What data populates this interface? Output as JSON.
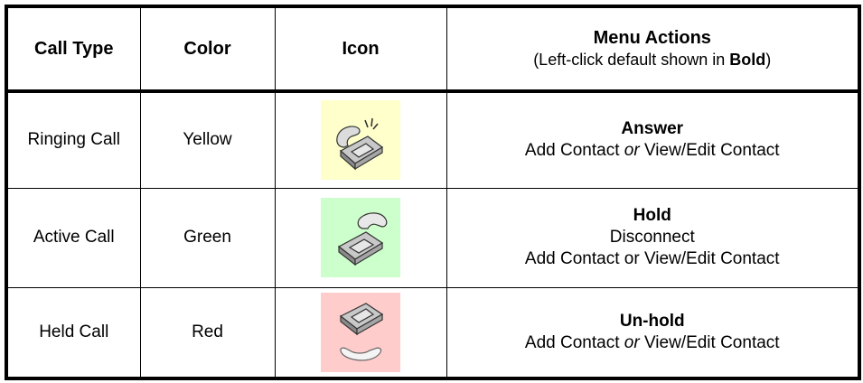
{
  "header": {
    "call_type": "Call Type",
    "color": "Color",
    "icon": "Icon",
    "menu_actions": "Menu Actions",
    "menu_sub_prefix": "(Left-click default shown in ",
    "menu_sub_bold": "Bold",
    "menu_sub_suffix": ")"
  },
  "rows": [
    {
      "call_type": "Ringing Call",
      "color": "Yellow",
      "icon_name": "ringing-phone-icon",
      "icon_bg": "#ffffcc",
      "actions": {
        "default": "Answer",
        "line1_a": "Add Contact ",
        "line1_or": "or",
        "line1_b": " View/Edit Contact"
      }
    },
    {
      "call_type": "Active Call",
      "color": "Green",
      "icon_name": "active-phone-icon",
      "icon_bg": "#ccffcc",
      "actions": {
        "default": "Hold",
        "line1": "Disconnect",
        "line2": "Add Contact or View/Edit Contact"
      }
    },
    {
      "call_type": "Held Call",
      "color": "Red",
      "icon_name": "held-phone-icon",
      "icon_bg": "#ffcccc",
      "actions": {
        "default": "Un-hold",
        "line1_a": "Add Contact ",
        "line1_or": "or",
        "line1_b": " View/Edit Contact"
      }
    }
  ]
}
